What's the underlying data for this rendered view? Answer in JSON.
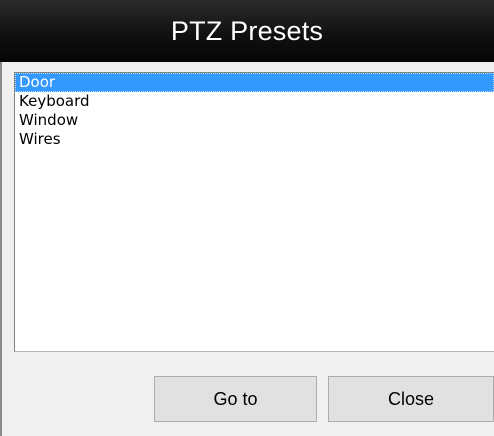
{
  "dialog": {
    "title": "PTZ Presets"
  },
  "presets": {
    "items": [
      {
        "label": "Door",
        "selected": true
      },
      {
        "label": "Keyboard",
        "selected": false
      },
      {
        "label": "Window",
        "selected": false
      },
      {
        "label": "Wires",
        "selected": false
      }
    ]
  },
  "buttons": {
    "goto_label": "Go to",
    "close_label": "Close"
  },
  "colors": {
    "title_bar": "#111111",
    "selection": "#3399ff",
    "button_face": "#e1e1e1"
  }
}
